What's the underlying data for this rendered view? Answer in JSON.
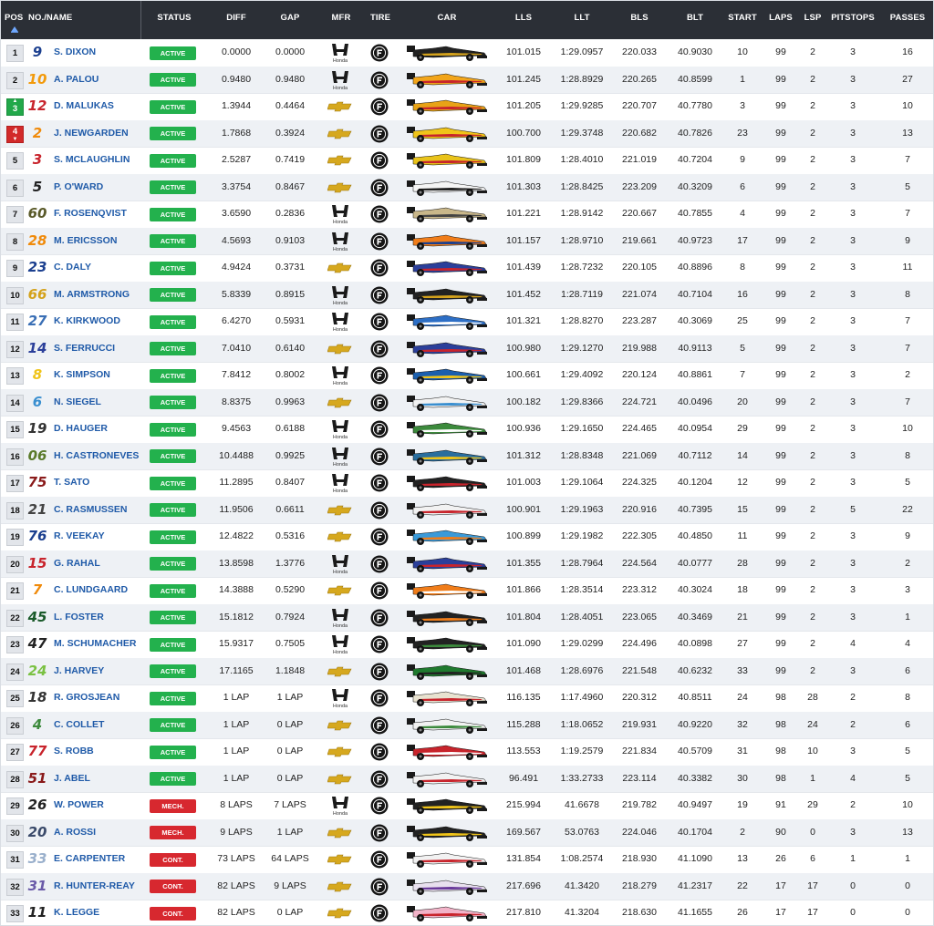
{
  "header": {
    "pos": "POS",
    "name": "NO./NAME",
    "status": "STATUS",
    "diff": "DIFF",
    "gap": "GAP",
    "mfr": "MFR",
    "tire": "TIRE",
    "car": "CAR",
    "lls": "LLS",
    "llt": "LLT",
    "bls": "BLS",
    "blt": "BLT",
    "start": "START",
    "laps": "LAPS",
    "lsp": "LSP",
    "pitstops": "PITSTOPS",
    "passes": "PASSES"
  },
  "colors": {
    "active": "#23b14d",
    "mech": "#d7282f",
    "cont": "#d7282f",
    "name_link": "#1f5aa8",
    "header_bg": "#2b2f36"
  },
  "icons": {
    "sort": "sort-up-icon",
    "honda": "honda-logo",
    "chevrolet": "chevrolet-logo",
    "tire": "firestone-tire-icon",
    "car": "indycar-livery-image"
  },
  "mfr_labels": {
    "honda": "Honda"
  },
  "rows": [
    {
      "pos": "1",
      "num": "9",
      "num_color": "#1b3f8f",
      "name": "S. DIXON",
      "status": "ACTIVE",
      "diff": "0.0000",
      "gap": "0.0000",
      "mfr": "honda",
      "car_color": "#222222",
      "car_accent": "#d4a21c",
      "lls": "101.015",
      "llt": "1:29.0957",
      "bls": "220.033",
      "blt": "40.9030",
      "start": "10",
      "laps": "99",
      "lsp": "2",
      "pitstops": "3",
      "passes": "16",
      "move": ""
    },
    {
      "pos": "2",
      "num": "10",
      "num_color": "#f29a0b",
      "name": "A. PALOU",
      "status": "ACTIVE",
      "diff": "0.9480",
      "gap": "0.9480",
      "mfr": "honda",
      "car_color": "#f2a51a",
      "car_accent": "#c8242c",
      "lls": "101.245",
      "llt": "1:28.8929",
      "bls": "220.265",
      "blt": "40.8599",
      "start": "1",
      "laps": "99",
      "lsp": "2",
      "pitstops": "3",
      "passes": "27",
      "move": ""
    },
    {
      "pos": "3",
      "num": "12",
      "num_color": "#c8242c",
      "name": "D. MALUKAS",
      "status": "ACTIVE",
      "diff": "1.3944",
      "gap": "0.4464",
      "mfr": "chevrolet",
      "car_color": "#e8a316",
      "car_accent": "#c8242c",
      "lls": "101.205",
      "llt": "1:29.9285",
      "bls": "220.707",
      "blt": "40.7780",
      "start": "3",
      "laps": "99",
      "lsp": "2",
      "pitstops": "3",
      "passes": "10",
      "move": "up"
    },
    {
      "pos": "4",
      "num": "2",
      "num_color": "#f08a0a",
      "name": "J. NEWGARDEN",
      "status": "ACTIVE",
      "diff": "1.7868",
      "gap": "0.3924",
      "mfr": "chevrolet",
      "car_color": "#f0c419",
      "car_accent": "#c8242c",
      "lls": "100.700",
      "llt": "1:29.3748",
      "bls": "220.682",
      "blt": "40.7826",
      "start": "23",
      "laps": "99",
      "lsp": "2",
      "pitstops": "3",
      "passes": "13",
      "move": "down"
    },
    {
      "pos": "5",
      "num": "3",
      "num_color": "#c8242c",
      "name": "S. MCLAUGHLIN",
      "status": "ACTIVE",
      "diff": "2.5287",
      "gap": "0.7419",
      "mfr": "chevrolet",
      "car_color": "#e9c31a",
      "car_accent": "#c8242c",
      "lls": "101.809",
      "llt": "1:28.4010",
      "bls": "221.019",
      "blt": "40.7204",
      "start": "9",
      "laps": "99",
      "lsp": "2",
      "pitstops": "3",
      "passes": "7",
      "move": ""
    },
    {
      "pos": "6",
      "num": "5",
      "num_color": "#222222",
      "name": "P. O'WARD",
      "status": "ACTIVE",
      "diff": "3.3754",
      "gap": "0.8467",
      "mfr": "chevrolet",
      "car_color": "#f5f5f5",
      "car_accent": "#222222",
      "lls": "101.303",
      "llt": "1:28.8425",
      "bls": "223.209",
      "blt": "40.3209",
      "start": "6",
      "laps": "99",
      "lsp": "2",
      "pitstops": "3",
      "passes": "5",
      "move": ""
    },
    {
      "pos": "7",
      "num": "60",
      "num_color": "#5a5a2a",
      "name": "F. ROSENQVIST",
      "status": "ACTIVE",
      "diff": "3.6590",
      "gap": "0.2836",
      "mfr": "honda",
      "car_color": "#c9b78a",
      "car_accent": "#444444",
      "lls": "101.221",
      "llt": "1:28.9142",
      "bls": "220.667",
      "blt": "40.7855",
      "start": "4",
      "laps": "99",
      "lsp": "2",
      "pitstops": "3",
      "passes": "7",
      "move": ""
    },
    {
      "pos": "8",
      "num": "28",
      "num_color": "#f08a0a",
      "name": "M. ERICSSON",
      "status": "ACTIVE",
      "diff": "4.5693",
      "gap": "0.9103",
      "mfr": "honda",
      "car_color": "#f07d1a",
      "car_accent": "#1b3f8f",
      "lls": "101.157",
      "llt": "1:28.9710",
      "bls": "219.661",
      "blt": "40.9723",
      "start": "17",
      "laps": "99",
      "lsp": "2",
      "pitstops": "3",
      "passes": "9",
      "move": ""
    },
    {
      "pos": "9",
      "num": "23",
      "num_color": "#1b3f8f",
      "name": "C. DALY",
      "status": "ACTIVE",
      "diff": "4.9424",
      "gap": "0.3731",
      "mfr": "chevrolet",
      "car_color": "#2b3f9a",
      "car_accent": "#c8242c",
      "lls": "101.439",
      "llt": "1:28.7232",
      "bls": "220.105",
      "blt": "40.8896",
      "start": "8",
      "laps": "99",
      "lsp": "2",
      "pitstops": "3",
      "passes": "11",
      "move": ""
    },
    {
      "pos": "10",
      "num": "66",
      "num_color": "#d4a21c",
      "name": "M. ARMSTRONG",
      "status": "ACTIVE",
      "diff": "5.8339",
      "gap": "0.8915",
      "mfr": "honda",
      "car_color": "#222222",
      "car_accent": "#d4a21c",
      "lls": "101.452",
      "llt": "1:28.7119",
      "bls": "221.074",
      "blt": "40.7104",
      "start": "16",
      "laps": "99",
      "lsp": "2",
      "pitstops": "3",
      "passes": "8",
      "move": ""
    },
    {
      "pos": "11",
      "num": "27",
      "num_color": "#3a6fb5",
      "name": "K. KIRKWOOD",
      "status": "ACTIVE",
      "diff": "6.4270",
      "gap": "0.5931",
      "mfr": "honda",
      "car_color": "#2d6fc6",
      "car_accent": "#ffffff",
      "lls": "101.321",
      "llt": "1:28.8270",
      "bls": "223.287",
      "blt": "40.3069",
      "start": "25",
      "laps": "99",
      "lsp": "2",
      "pitstops": "3",
      "passes": "7",
      "move": ""
    },
    {
      "pos": "12",
      "num": "14",
      "num_color": "#2b3f9a",
      "name": "S. FERRUCCI",
      "status": "ACTIVE",
      "diff": "7.0410",
      "gap": "0.6140",
      "mfr": "chevrolet",
      "car_color": "#2b3f9a",
      "car_accent": "#c8242c",
      "lls": "100.980",
      "llt": "1:29.1270",
      "bls": "219.988",
      "blt": "40.9113",
      "start": "5",
      "laps": "99",
      "lsp": "2",
      "pitstops": "3",
      "passes": "7",
      "move": ""
    },
    {
      "pos": "13",
      "num": "8",
      "num_color": "#f0c419",
      "name": "K. SIMPSON",
      "status": "ACTIVE",
      "diff": "7.8412",
      "gap": "0.8002",
      "mfr": "honda",
      "car_color": "#1b5fae",
      "car_accent": "#f0c419",
      "lls": "100.661",
      "llt": "1:29.4092",
      "bls": "220.124",
      "blt": "40.8861",
      "start": "7",
      "laps": "99",
      "lsp": "2",
      "pitstops": "3",
      "passes": "2",
      "move": ""
    },
    {
      "pos": "14",
      "num": "6",
      "num_color": "#3a8fd0",
      "name": "N. SIEGEL",
      "status": "ACTIVE",
      "diff": "8.8375",
      "gap": "0.9963",
      "mfr": "chevrolet",
      "car_color": "#f2f2f2",
      "car_accent": "#3a8fd0",
      "lls": "100.182",
      "llt": "1:29.8366",
      "bls": "224.721",
      "blt": "40.0496",
      "start": "20",
      "laps": "99",
      "lsp": "2",
      "pitstops": "3",
      "passes": "7",
      "move": ""
    },
    {
      "pos": "15",
      "num": "19",
      "num_color": "#333333",
      "name": "D. HAUGER",
      "status": "ACTIVE",
      "diff": "9.4563",
      "gap": "0.6188",
      "mfr": "honda",
      "car_color": "#3c8a3c",
      "car_accent": "#ffffff",
      "lls": "100.936",
      "llt": "1:29.1650",
      "bls": "224.465",
      "blt": "40.0954",
      "start": "29",
      "laps": "99",
      "lsp": "2",
      "pitstops": "3",
      "passes": "10",
      "move": ""
    },
    {
      "pos": "16",
      "num": "06",
      "num_color": "#5a7a2a",
      "name": "H. CASTRONEVES",
      "status": "ACTIVE",
      "diff": "10.4488",
      "gap": "0.9925",
      "mfr": "honda",
      "car_color": "#2a6e9e",
      "car_accent": "#f0c419",
      "lls": "101.312",
      "llt": "1:28.8348",
      "bls": "221.069",
      "blt": "40.7112",
      "start": "14",
      "laps": "99",
      "lsp": "2",
      "pitstops": "3",
      "passes": "8",
      "move": ""
    },
    {
      "pos": "17",
      "num": "75",
      "num_color": "#8a1a1a",
      "name": "T. SATO",
      "status": "ACTIVE",
      "diff": "11.2895",
      "gap": "0.8407",
      "mfr": "honda",
      "car_color": "#222222",
      "car_accent": "#c8242c",
      "lls": "101.003",
      "llt": "1:29.1064",
      "bls": "224.325",
      "blt": "40.1204",
      "start": "12",
      "laps": "99",
      "lsp": "2",
      "pitstops": "3",
      "passes": "5",
      "move": ""
    },
    {
      "pos": "18",
      "num": "21",
      "num_color": "#444444",
      "name": "C. RASMUSSEN",
      "status": "ACTIVE",
      "diff": "11.9506",
      "gap": "0.6611",
      "mfr": "chevrolet",
      "car_color": "#f2f2f2",
      "car_accent": "#c8242c",
      "lls": "100.901",
      "llt": "1:29.1963",
      "bls": "220.916",
      "blt": "40.7395",
      "start": "15",
      "laps": "99",
      "lsp": "2",
      "pitstops": "5",
      "passes": "22",
      "move": ""
    },
    {
      "pos": "19",
      "num": "76",
      "num_color": "#1b3f8f",
      "name": "R. VEEKAY",
      "status": "ACTIVE",
      "diff": "12.4822",
      "gap": "0.5316",
      "mfr": "chevrolet",
      "car_color": "#3a9ad9",
      "car_accent": "#f07d1a",
      "lls": "100.899",
      "llt": "1:29.1982",
      "bls": "222.305",
      "blt": "40.4850",
      "start": "11",
      "laps": "99",
      "lsp": "2",
      "pitstops": "3",
      "passes": "9",
      "move": ""
    },
    {
      "pos": "20",
      "num": "15",
      "num_color": "#c8242c",
      "name": "G. RAHAL",
      "status": "ACTIVE",
      "diff": "13.8598",
      "gap": "1.3776",
      "mfr": "honda",
      "car_color": "#2b3f9a",
      "car_accent": "#c8242c",
      "lls": "101.355",
      "llt": "1:28.7964",
      "bls": "224.564",
      "blt": "40.0777",
      "start": "28",
      "laps": "99",
      "lsp": "2",
      "pitstops": "3",
      "passes": "2",
      "move": ""
    },
    {
      "pos": "21",
      "num": "7",
      "num_color": "#f08a0a",
      "name": "C. LUNDGAARD",
      "status": "ACTIVE",
      "diff": "14.3888",
      "gap": "0.5290",
      "mfr": "chevrolet",
      "car_color": "#f07d1a",
      "car_accent": "#ffffff",
      "lls": "101.866",
      "llt": "1:28.3514",
      "bls": "223.312",
      "blt": "40.3024",
      "start": "18",
      "laps": "99",
      "lsp": "2",
      "pitstops": "3",
      "passes": "3",
      "move": ""
    },
    {
      "pos": "22",
      "num": "45",
      "num_color": "#1a5a2a",
      "name": "L. FOSTER",
      "status": "ACTIVE",
      "diff": "15.1812",
      "gap": "0.7924",
      "mfr": "honda",
      "car_color": "#222222",
      "car_accent": "#f07d1a",
      "lls": "101.804",
      "llt": "1:28.4051",
      "bls": "223.065",
      "blt": "40.3469",
      "start": "21",
      "laps": "99",
      "lsp": "2",
      "pitstops": "3",
      "passes": "1",
      "move": ""
    },
    {
      "pos": "23",
      "num": "47",
      "num_color": "#222222",
      "name": "M. SCHUMACHER",
      "status": "ACTIVE",
      "diff": "15.9317",
      "gap": "0.7505",
      "mfr": "honda",
      "car_color": "#222222",
      "car_accent": "#3c8a3c",
      "lls": "101.090",
      "llt": "1:29.0299",
      "bls": "224.496",
      "blt": "40.0898",
      "start": "27",
      "laps": "99",
      "lsp": "2",
      "pitstops": "4",
      "passes": "4",
      "move": ""
    },
    {
      "pos": "24",
      "num": "24",
      "num_color": "#7ac142",
      "name": "J. HARVEY",
      "status": "ACTIVE",
      "diff": "17.1165",
      "gap": "1.1848",
      "mfr": "chevrolet",
      "car_color": "#1f7a2e",
      "car_accent": "#222222",
      "lls": "101.468",
      "llt": "1:28.6976",
      "bls": "221.548",
      "blt": "40.6232",
      "start": "33",
      "laps": "99",
      "lsp": "2",
      "pitstops": "3",
      "passes": "6",
      "move": ""
    },
    {
      "pos": "25",
      "num": "18",
      "num_color": "#333333",
      "name": "R. GROSJEAN",
      "status": "ACTIVE",
      "diff": "1 LAP",
      "gap": "1 LAP",
      "mfr": "honda",
      "car_color": "#e8e2d0",
      "car_accent": "#c8242c",
      "lls": "116.135",
      "llt": "1:17.4960",
      "bls": "220.312",
      "blt": "40.8511",
      "start": "24",
      "laps": "98",
      "lsp": "28",
      "pitstops": "2",
      "passes": "8",
      "move": ""
    },
    {
      "pos": "26",
      "num": "4",
      "num_color": "#3c8a3c",
      "name": "C. COLLET",
      "status": "ACTIVE",
      "diff": "1 LAP",
      "gap": "0 LAP",
      "mfr": "chevrolet",
      "car_color": "#f2f2f2",
      "car_accent": "#3c8a3c",
      "lls": "115.288",
      "llt": "1:18.0652",
      "bls": "219.931",
      "blt": "40.9220",
      "start": "32",
      "laps": "98",
      "lsp": "24",
      "pitstops": "2",
      "passes": "6",
      "move": ""
    },
    {
      "pos": "27",
      "num": "77",
      "num_color": "#c8242c",
      "name": "S. ROBB",
      "status": "ACTIVE",
      "diff": "1 LAP",
      "gap": "0 LAP",
      "mfr": "chevrolet",
      "car_color": "#c8242c",
      "car_accent": "#ffffff",
      "lls": "113.553",
      "llt": "1:19.2579",
      "bls": "221.834",
      "blt": "40.5709",
      "start": "31",
      "laps": "98",
      "lsp": "10",
      "pitstops": "3",
      "passes": "5",
      "move": ""
    },
    {
      "pos": "28",
      "num": "51",
      "num_color": "#8a1a1a",
      "name": "J. ABEL",
      "status": "ACTIVE",
      "diff": "1 LAP",
      "gap": "0 LAP",
      "mfr": "chevrolet",
      "car_color": "#f2f2f2",
      "car_accent": "#c8242c",
      "lls": "96.491",
      "llt": "1:33.2733",
      "bls": "223.114",
      "blt": "40.3382",
      "start": "30",
      "laps": "98",
      "lsp": "1",
      "pitstops": "4",
      "passes": "5",
      "move": ""
    },
    {
      "pos": "29",
      "num": "26",
      "num_color": "#222222",
      "name": "W. POWER",
      "status": "MECH.",
      "diff": "8 LAPS",
      "gap": "7 LAPS",
      "mfr": "honda",
      "car_color": "#222222",
      "car_accent": "#f0c419",
      "lls": "215.994",
      "llt": "41.6678",
      "bls": "219.782",
      "blt": "40.9497",
      "start": "19",
      "laps": "91",
      "lsp": "29",
      "pitstops": "2",
      "passes": "10",
      "move": ""
    },
    {
      "pos": "30",
      "num": "20",
      "num_color": "#3a4a6a",
      "name": "A. ROSSI",
      "status": "MECH.",
      "diff": "9 LAPS",
      "gap": "1 LAP",
      "mfr": "chevrolet",
      "car_color": "#222222",
      "car_accent": "#f0c419",
      "lls": "169.567",
      "llt": "53.0763",
      "bls": "224.046",
      "blt": "40.1704",
      "start": "2",
      "laps": "90",
      "lsp": "0",
      "pitstops": "3",
      "passes": "13",
      "move": ""
    },
    {
      "pos": "31",
      "num": "33",
      "num_color": "#9ab0cc",
      "name": "E. CARPENTER",
      "status": "CONT.",
      "diff": "73 LAPS",
      "gap": "64 LAPS",
      "mfr": "chevrolet",
      "car_color": "#f2f2f2",
      "car_accent": "#c8242c",
      "lls": "131.854",
      "llt": "1:08.2574",
      "bls": "218.930",
      "blt": "41.1090",
      "start": "13",
      "laps": "26",
      "lsp": "6",
      "pitstops": "1",
      "passes": "1",
      "move": ""
    },
    {
      "pos": "32",
      "num": "31",
      "num_color": "#6a5aa8",
      "name": "R. HUNTER-REAY",
      "status": "CONT.",
      "diff": "82 LAPS",
      "gap": "9 LAPS",
      "mfr": "chevrolet",
      "car_color": "#e8e0ee",
      "car_accent": "#6a3a9a",
      "lls": "217.696",
      "llt": "41.3420",
      "bls": "218.279",
      "blt": "41.2317",
      "start": "22",
      "laps": "17",
      "lsp": "17",
      "pitstops": "0",
      "passes": "0",
      "move": ""
    },
    {
      "pos": "33",
      "num": "11",
      "num_color": "#222222",
      "name": "K. LEGGE",
      "status": "CONT.",
      "diff": "82 LAPS",
      "gap": "0 LAP",
      "mfr": "chevrolet",
      "car_color": "#f2b3c8",
      "car_accent": "#c8242c",
      "lls": "217.810",
      "llt": "41.3204",
      "bls": "218.630",
      "blt": "41.1655",
      "start": "26",
      "laps": "17",
      "lsp": "17",
      "pitstops": "0",
      "passes": "0",
      "move": ""
    }
  ]
}
